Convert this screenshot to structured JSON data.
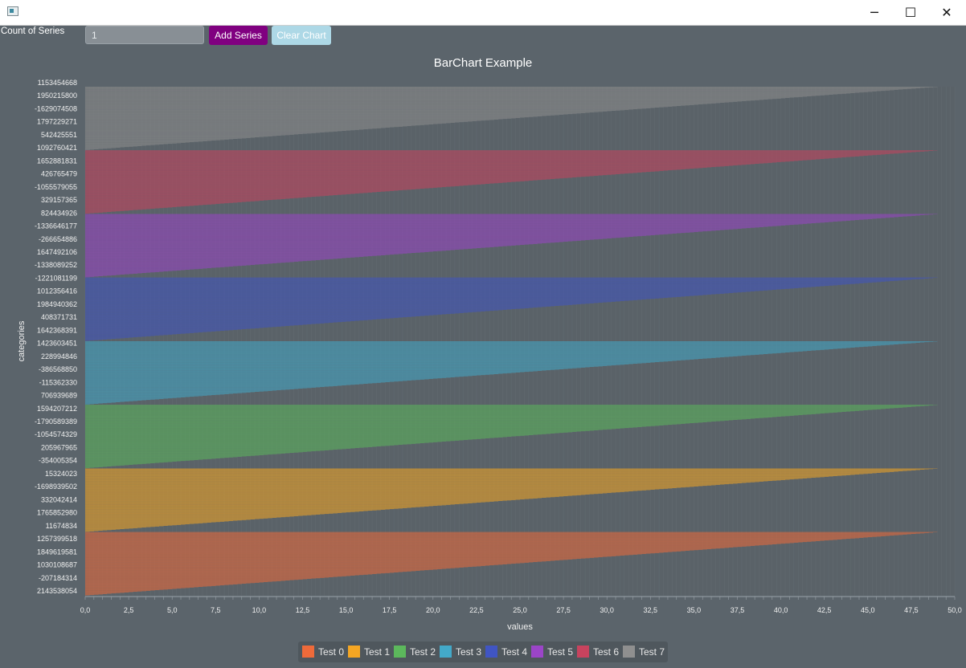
{
  "window": {
    "min_glyph": "─",
    "max_glyph": "☐",
    "close_glyph": "✕"
  },
  "toolbar": {
    "count_label": "Count of Series",
    "count_value": "1",
    "add_series_label": "Add Series",
    "clear_chart_label": "Clear Chart"
  },
  "colors": {
    "background": "#5b646b",
    "add_series": "#800080",
    "clear_chart": "#add8e6"
  },
  "chart_data": {
    "type": "bar",
    "orientation": "horizontal",
    "title": "BarChart Example",
    "xlabel": "values",
    "ylabel": "categories",
    "xlim": [
      0,
      50
    ],
    "x_ticks": [
      "0,0",
      "2,5",
      "5,0",
      "7,5",
      "10,0",
      "12,5",
      "15,0",
      "17,5",
      "20,0",
      "22,5",
      "25,0",
      "27,5",
      "30,0",
      "32,5",
      "35,0",
      "37,5",
      "40,0",
      "42,5",
      "45,0",
      "47,5",
      "50,0"
    ],
    "category_labels": [
      "2143538054",
      "-207184314",
      "1030108687",
      "1849619581",
      "1257399518",
      "11674834",
      "1765852980",
      "332042414",
      "-1698939502",
      "15324023",
      "-354005354",
      "205967965",
      "-1054574329",
      "-1790589389",
      "1594207212",
      "706939689",
      "-115362330",
      "-386568850",
      "228994846",
      "1423603451",
      "1642368391",
      "408371731",
      "1984940362",
      "1012356416",
      "-1221081199",
      "-1338089252",
      "1647492106",
      "-266654886",
      "-1336646177",
      "824434926",
      "329157365",
      "-1055579055",
      "426765479",
      "1652881831",
      "1092760421",
      "542425551",
      "1797229271",
      "-1629074508",
      "1950215800",
      "1153454668"
    ],
    "series": [
      {
        "name": "Test 0",
        "color": "#ee6a3a",
        "values_from_zero_step": 0.25,
        "count": 197
      },
      {
        "name": "Test 1",
        "color": "#f5a623",
        "values_from_zero_step": 0.25,
        "count": 197
      },
      {
        "name": "Test 2",
        "color": "#5cb85c",
        "values_from_zero_step": 0.25,
        "count": 197
      },
      {
        "name": "Test 3",
        "color": "#43a9c9",
        "values_from_zero_step": 0.25,
        "count": 197
      },
      {
        "name": "Test 4",
        "color": "#4055c3",
        "values_from_zero_step": 0.25,
        "count": 197
      },
      {
        "name": "Test 5",
        "color": "#9b45c8",
        "values_from_zero_step": 0.25,
        "count": 197
      },
      {
        "name": "Test 6",
        "color": "#c8435e",
        "values_from_zero_step": 0.25,
        "count": 197
      },
      {
        "name": "Test 7",
        "color": "#8f8f8f",
        "values_from_zero_step": 0.25,
        "count": 197
      }
    ],
    "grid": true,
    "legend_placement": "bottom"
  }
}
